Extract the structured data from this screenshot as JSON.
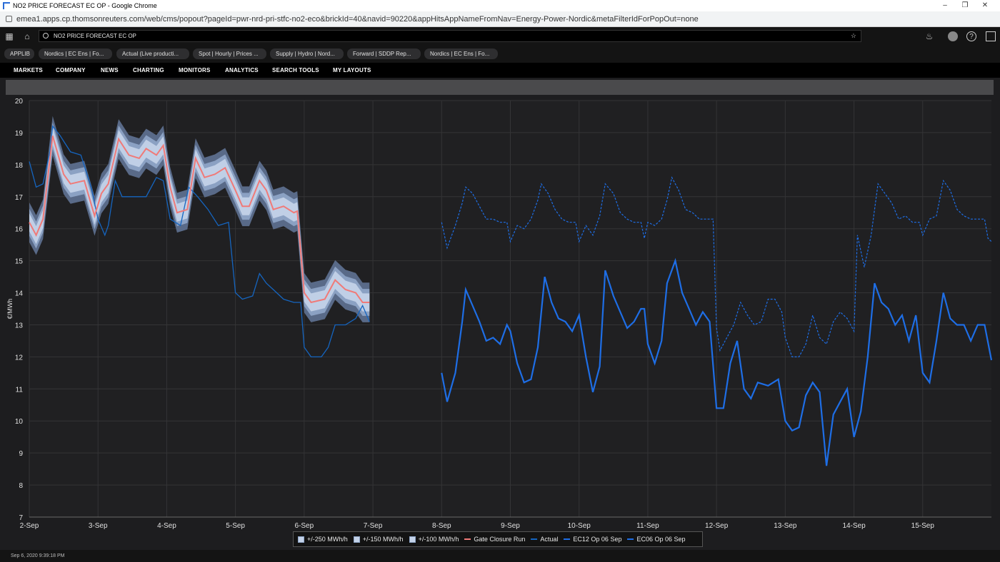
{
  "window": {
    "title": "NO2 PRICE FORECAST EC OP - Google Chrome",
    "url": "emea1.apps.cp.thomsonreuters.com/web/cms/popout?pageId=pwr-nrd-pri-stfc-no2-eco&brickId=40&navid=90220&appHitsAppNameFromNav=Energy-Power-Nordic&metaFilterIdForPopOut=none"
  },
  "search": {
    "value": "NO2 PRICE FORECAST EC OP"
  },
  "tabs": [
    "APPLIB",
    "Nordics | EC Ens | Fo...",
    "Actual (Live producti...",
    "Spot | Hourly | Prices ...",
    "Supply | Hydro | Nord...",
    "Forward | SDDP Rep...",
    "Nordics | EC Ens | Fo..."
  ],
  "menu": [
    "MARKETS",
    "COMPANY",
    "NEWS",
    "CHARTING",
    "MONITORS",
    "ANALYTICS",
    "SEARCH TOOLS",
    "MY LAYOUTS"
  ],
  "footer": {
    "timestamp": "Sep 6, 2020 9:39:18 PM"
  },
  "icons": [
    "grid-icon",
    "home-icon",
    "search-icon",
    "star-icon",
    "bell-icon",
    "avatar",
    "help-icon",
    "apps-icon"
  ],
  "colors": {
    "band250": "#5d6f8e",
    "band150": "#8ea4c6",
    "band100": "#c3d2e8",
    "gate": "#f07a78",
    "actual": "#1565c0",
    "ec12": "#1e6ee6",
    "ec06": "#1e6ee6"
  },
  "chart_data": {
    "type": "line",
    "ylabel": "€/MWh",
    "ylim": [
      7,
      20
    ],
    "yticks": [
      7,
      8,
      9,
      10,
      11,
      12,
      13,
      14,
      15,
      16,
      17,
      18,
      19,
      20
    ],
    "xlim": [
      0,
      14
    ],
    "xticks": [
      {
        "x": 0,
        "label": "2-Sep"
      },
      {
        "x": 1,
        "label": "3-Sep"
      },
      {
        "x": 2,
        "label": "4-Sep"
      },
      {
        "x": 3,
        "label": "5-Sep"
      },
      {
        "x": 4,
        "label": "6-Sep"
      },
      {
        "x": 5,
        "label": "7-Sep"
      },
      {
        "x": 6,
        "label": "8-Sep"
      },
      {
        "x": 7,
        "label": "9-Sep"
      },
      {
        "x": 8,
        "label": "10-Sep"
      },
      {
        "x": 9,
        "label": "11-Sep"
      },
      {
        "x": 10,
        "label": "12-Sep"
      },
      {
        "x": 11,
        "label": "13-Sep"
      },
      {
        "x": 12,
        "label": "14-Sep"
      },
      {
        "x": 13,
        "label": "15-Sep"
      }
    ],
    "legend": [
      "+/-250 MWh/h",
      "+/-150 MWh/h",
      "+/-100 MWh/h",
      "Gate Closure Run",
      "Actual",
      "EC12 Op 06 Sep",
      "EC06 Op 06 Sep"
    ],
    "series": [
      {
        "name": "Gate Closure Run",
        "band_halfwidths": [
          0.62,
          0.42,
          0.28
        ],
        "points": [
          [
            0,
            16.2
          ],
          [
            0.1,
            15.8
          ],
          [
            0.2,
            16.3
          ],
          [
            0.34,
            18.9
          ],
          [
            0.5,
            17.7
          ],
          [
            0.6,
            17.4
          ],
          [
            0.8,
            17.5
          ],
          [
            0.95,
            16.4
          ],
          [
            1.05,
            17.1
          ],
          [
            1.15,
            17.4
          ],
          [
            1.3,
            18.8
          ],
          [
            1.45,
            18.3
          ],
          [
            1.6,
            18.2
          ],
          [
            1.7,
            18.5
          ],
          [
            1.85,
            18.3
          ],
          [
            1.95,
            18.6
          ],
          [
            2.05,
            17.3
          ],
          [
            2.15,
            16.5
          ],
          [
            2.3,
            16.6
          ],
          [
            2.42,
            18.2
          ],
          [
            2.55,
            17.6
          ],
          [
            2.7,
            17.7
          ],
          [
            2.85,
            17.9
          ],
          [
            3.0,
            17.2
          ],
          [
            3.1,
            16.7
          ],
          [
            3.2,
            16.7
          ],
          [
            3.35,
            17.5
          ],
          [
            3.45,
            17.2
          ],
          [
            3.55,
            16.6
          ],
          [
            3.7,
            16.7
          ],
          [
            3.85,
            16.5
          ],
          [
            3.9,
            16.55
          ],
          [
            4.0,
            14.0
          ],
          [
            4.1,
            13.7
          ],
          [
            4.3,
            13.8
          ],
          [
            4.45,
            14.4
          ],
          [
            4.6,
            14.1
          ],
          [
            4.75,
            14.0
          ],
          [
            4.85,
            13.7
          ],
          [
            4.95,
            13.7
          ]
        ]
      },
      {
        "name": "Actual",
        "points": [
          [
            0,
            18.1
          ],
          [
            0.1,
            17.3
          ],
          [
            0.2,
            17.4
          ],
          [
            0.3,
            18.4
          ],
          [
            0.34,
            19.2
          ],
          [
            0.45,
            18.9
          ],
          [
            0.6,
            18.4
          ],
          [
            0.75,
            18.3
          ],
          [
            0.9,
            17.3
          ],
          [
            1.0,
            16.3
          ],
          [
            1.1,
            15.8
          ],
          [
            1.15,
            16.1
          ],
          [
            1.25,
            17.5
          ],
          [
            1.35,
            17.0
          ],
          [
            1.5,
            17.0
          ],
          [
            1.6,
            17.0
          ],
          [
            1.7,
            17.0
          ],
          [
            1.85,
            17.6
          ],
          [
            1.95,
            17.5
          ],
          [
            2.05,
            16.3
          ],
          [
            2.2,
            16.1
          ],
          [
            2.32,
            17.3
          ],
          [
            2.45,
            17.0
          ],
          [
            2.6,
            16.6
          ],
          [
            2.75,
            16.1
          ],
          [
            2.9,
            16.2
          ],
          [
            3.0,
            14.0
          ],
          [
            3.1,
            13.8
          ],
          [
            3.25,
            13.9
          ],
          [
            3.35,
            14.6
          ],
          [
            3.45,
            14.3
          ],
          [
            3.55,
            14.1
          ],
          [
            3.7,
            13.8
          ],
          [
            3.85,
            13.7
          ],
          [
            3.95,
            13.7
          ],
          [
            4.0,
            12.3
          ],
          [
            4.1,
            12.0
          ],
          [
            4.25,
            12.0
          ],
          [
            4.35,
            12.3
          ],
          [
            4.45,
            13.0
          ],
          [
            4.6,
            13.0
          ],
          [
            4.75,
            13.2
          ],
          [
            4.85,
            13.6
          ],
          [
            4.95,
            13.1
          ]
        ]
      },
      {
        "name": "EC12 Op 06 Sep",
        "points": [
          [
            6.0,
            11.5
          ],
          [
            6.08,
            10.6
          ],
          [
            6.2,
            11.5
          ],
          [
            6.3,
            13.1
          ],
          [
            6.35,
            14.1
          ],
          [
            6.45,
            13.6
          ],
          [
            6.55,
            13.1
          ],
          [
            6.65,
            12.5
          ],
          [
            6.75,
            12.6
          ],
          [
            6.85,
            12.4
          ],
          [
            6.95,
            13.0
          ],
          [
            7.0,
            12.8
          ],
          [
            7.1,
            11.8
          ],
          [
            7.2,
            11.2
          ],
          [
            7.3,
            11.3
          ],
          [
            7.4,
            12.3
          ],
          [
            7.5,
            14.5
          ],
          [
            7.6,
            13.7
          ],
          [
            7.7,
            13.2
          ],
          [
            7.8,
            13.1
          ],
          [
            7.9,
            12.8
          ],
          [
            8.0,
            13.3
          ],
          [
            8.1,
            12.0
          ],
          [
            8.2,
            10.9
          ],
          [
            8.3,
            11.7
          ],
          [
            8.38,
            14.7
          ],
          [
            8.5,
            13.9
          ],
          [
            8.6,
            13.4
          ],
          [
            8.7,
            12.9
          ],
          [
            8.8,
            13.1
          ],
          [
            8.9,
            13.5
          ],
          [
            8.95,
            13.5
          ],
          [
            9.0,
            12.4
          ],
          [
            9.1,
            11.8
          ],
          [
            9.2,
            12.5
          ],
          [
            9.28,
            14.3
          ],
          [
            9.4,
            15.0
          ],
          [
            9.5,
            14.0
          ],
          [
            9.6,
            13.5
          ],
          [
            9.7,
            13.0
          ],
          [
            9.8,
            13.4
          ],
          [
            9.9,
            13.1
          ],
          [
            10.0,
            10.4
          ],
          [
            10.1,
            10.4
          ],
          [
            10.2,
            11.8
          ],
          [
            10.3,
            12.5
          ],
          [
            10.4,
            11.0
          ],
          [
            10.5,
            10.7
          ],
          [
            10.6,
            11.2
          ],
          [
            10.75,
            11.1
          ],
          [
            10.9,
            11.3
          ],
          [
            11.0,
            10.0
          ],
          [
            11.1,
            9.7
          ],
          [
            11.2,
            9.8
          ],
          [
            11.3,
            10.8
          ],
          [
            11.4,
            11.2
          ],
          [
            11.5,
            10.9
          ],
          [
            11.6,
            8.6
          ],
          [
            11.7,
            10.2
          ],
          [
            11.8,
            10.6
          ],
          [
            11.9,
            11.0
          ],
          [
            12.0,
            9.5
          ],
          [
            12.1,
            10.3
          ],
          [
            12.2,
            12.0
          ],
          [
            12.3,
            14.3
          ],
          [
            12.4,
            13.7
          ],
          [
            12.5,
            13.5
          ],
          [
            12.6,
            13.0
          ],
          [
            12.7,
            13.3
          ],
          [
            12.8,
            12.5
          ],
          [
            12.9,
            13.3
          ],
          [
            13.0,
            11.5
          ],
          [
            13.1,
            11.2
          ],
          [
            13.2,
            12.5
          ],
          [
            13.3,
            14.0
          ],
          [
            13.4,
            13.2
          ],
          [
            13.5,
            13.0
          ],
          [
            13.6,
            13.0
          ],
          [
            13.7,
            12.5
          ],
          [
            13.8,
            13.0
          ],
          [
            13.9,
            13.0
          ],
          [
            14.0,
            11.9
          ]
        ]
      },
      {
        "name": "EC06 Op 06 Sep",
        "points": [
          [
            6.0,
            16.2
          ],
          [
            6.08,
            15.4
          ],
          [
            6.2,
            16.1
          ],
          [
            6.3,
            16.8
          ],
          [
            6.35,
            17.3
          ],
          [
            6.45,
            17.1
          ],
          [
            6.55,
            16.7
          ],
          [
            6.65,
            16.3
          ],
          [
            6.75,
            16.3
          ],
          [
            6.85,
            16.2
          ],
          [
            6.95,
            16.2
          ],
          [
            7.0,
            15.6
          ],
          [
            7.1,
            16.1
          ],
          [
            7.2,
            16.0
          ],
          [
            7.3,
            16.3
          ],
          [
            7.4,
            16.9
          ],
          [
            7.45,
            17.4
          ],
          [
            7.55,
            17.1
          ],
          [
            7.65,
            16.6
          ],
          [
            7.75,
            16.3
          ],
          [
            7.85,
            16.2
          ],
          [
            7.95,
            16.2
          ],
          [
            8.0,
            15.6
          ],
          [
            8.1,
            16.1
          ],
          [
            8.2,
            15.8
          ],
          [
            8.3,
            16.4
          ],
          [
            8.38,
            17.4
          ],
          [
            8.5,
            17.1
          ],
          [
            8.6,
            16.5
          ],
          [
            8.7,
            16.3
          ],
          [
            8.8,
            16.2
          ],
          [
            8.9,
            16.2
          ],
          [
            8.95,
            15.7
          ],
          [
            9.0,
            16.2
          ],
          [
            9.1,
            16.1
          ],
          [
            9.2,
            16.3
          ],
          [
            9.28,
            16.9
          ],
          [
            9.35,
            17.6
          ],
          [
            9.45,
            17.2
          ],
          [
            9.55,
            16.6
          ],
          [
            9.65,
            16.5
          ],
          [
            9.75,
            16.3
          ],
          [
            9.85,
            16.3
          ],
          [
            9.95,
            16.3
          ],
          [
            10.0,
            12.9
          ],
          [
            10.05,
            12.2
          ],
          [
            10.15,
            12.6
          ],
          [
            10.25,
            13.0
          ],
          [
            10.35,
            13.7
          ],
          [
            10.45,
            13.3
          ],
          [
            10.55,
            13.0
          ],
          [
            10.65,
            13.1
          ],
          [
            10.75,
            13.8
          ],
          [
            10.85,
            13.8
          ],
          [
            10.95,
            13.4
          ],
          [
            11.0,
            12.6
          ],
          [
            11.1,
            12.0
          ],
          [
            11.2,
            12.0
          ],
          [
            11.3,
            12.4
          ],
          [
            11.4,
            13.3
          ],
          [
            11.5,
            12.6
          ],
          [
            11.6,
            12.4
          ],
          [
            11.7,
            13.1
          ],
          [
            11.8,
            13.4
          ],
          [
            11.9,
            13.2
          ],
          [
            12.0,
            12.8
          ],
          [
            12.05,
            15.8
          ],
          [
            12.15,
            14.8
          ],
          [
            12.25,
            15.8
          ],
          [
            12.35,
            17.4
          ],
          [
            12.45,
            17.1
          ],
          [
            12.55,
            16.8
          ],
          [
            12.65,
            16.3
          ],
          [
            12.75,
            16.4
          ],
          [
            12.85,
            16.2
          ],
          [
            12.95,
            16.2
          ],
          [
            13.0,
            15.8
          ],
          [
            13.1,
            16.3
          ],
          [
            13.2,
            16.4
          ],
          [
            13.3,
            17.5
          ],
          [
            13.4,
            17.2
          ],
          [
            13.5,
            16.6
          ],
          [
            13.6,
            16.4
          ],
          [
            13.7,
            16.3
          ],
          [
            13.8,
            16.3
          ],
          [
            13.9,
            16.3
          ],
          [
            13.95,
            15.7
          ],
          [
            14.0,
            15.6
          ]
        ]
      }
    ]
  }
}
